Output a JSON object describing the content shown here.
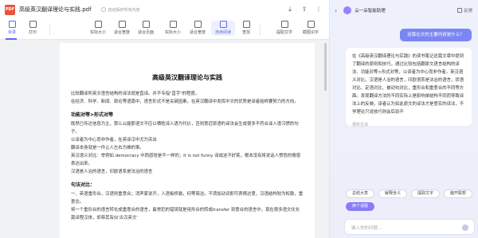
{
  "file": {
    "badge": "PDF",
    "title": "高级英汉翻译理论与实践.pdf",
    "autosave": "自动保存所有内容"
  },
  "toolbar": {
    "items": [
      "目录",
      "打印",
      "实际大小",
      "适合宽度",
      "适合页面",
      "实际大小",
      "适合宽度",
      "连续阅读",
      "查找",
      "提取文字",
      "截图识字"
    ],
    "active_index": 0,
    "selected_index": 7
  },
  "document": {
    "title": "高级英汉翻译理论与实践",
    "paragraphs": [
      "比较翻译所英文语言结构的译法就是直译。并不专指\"直字\"的程度。",
      "在经济、科学、新闻、政论等语篇中，语言形式不是关键因素，在英汉翻译中发挥中文的优势是译者始终要努力的方向。"
    ],
    "heading1": "功能对等>形式对等",
    "paragraphs2": [
      "既然已传达信息为主，那么公能那语文不应以牺牲译入语为代价，否则意近原语的译法会生成很多不符合译入语习惯的句子。",
      "以译者为中心而非作者，在英译汉中尤为突出",
      "翻译本身就是一件让人左右为难的事。",
      "英汉语义对比：举例如 democracy 中西感觉是不一样的；It is not funny 译成这不好笑，根本没有将说话人愤怒的情感表达出来。",
      "汉语是人治的语言，印欧语系是法治的语言"
    ],
    "heading2": "句法对比：",
    "paragraphs3": [
      "一、英语重形合，汉语则重意合；消声家说开，人语板桥霜，何等简洁，不须加动词即可表情达意，汉语结构较为松散，重意念。",
      "将一个重形合的语言转化成重意合的语言，最常犯的错误就是用形合的转成transfer 到意合的语言中，现在很多语文化长篇译程汉体，却恭其有似'古汉英文'"
    ]
  },
  "assistant": {
    "name": "云一朵智能助理",
    "feedback": "反馈",
    "user_question": "这篇论文的主要内容是什么？",
    "answer": "在《高级英汉翻译理论与实践》的读书笔记这篇文章中提到了翻译的原则和技巧，通过比较包括翻原文语言结构的译法、功能对等>形式对等，以读者为中心而非作者，英汉语义对比，汉语是人治的语言，印欧语系是法治的语言，状语对比、定语对比、被动句对比，重形合和重意合的不同等方面。发现翻译方法的不同实际上是影响单结构不同而导致译法上的反映，译者认为如此原文的译法才是意实的译法，不学理论只说技巧则会后劲不",
    "more_hint": "重新生成",
    "chips": [
      "总结大意",
      "解释含义",
      "提取文字",
      "脑开联想",
      "换个话题"
    ],
    "input_placeholder": "输入你的问题..."
  }
}
